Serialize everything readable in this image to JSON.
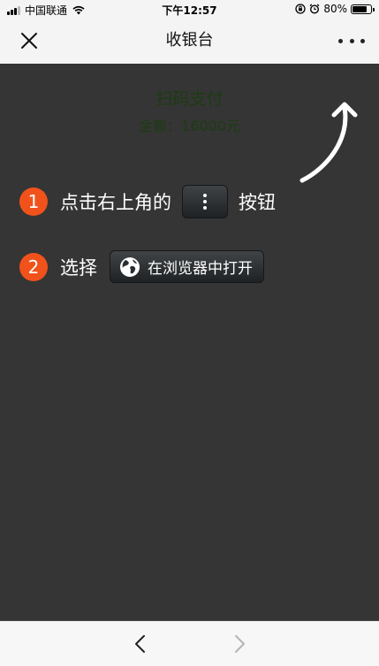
{
  "status_bar": {
    "carrier": "中国联通",
    "time": "下午12:57",
    "battery_text": "80%",
    "battery_level": 0.8,
    "signal_bars_active": 3,
    "signal_bars_total": 4,
    "icons": [
      "signal-icon",
      "wifi-icon",
      "lock-rotation-icon",
      "alarm-icon",
      "battery-icon"
    ]
  },
  "nav": {
    "title": "收银台",
    "close_icon": "close-icon",
    "more_icon": "more-dots-icon"
  },
  "page": {
    "pay_title": "扫码支付",
    "amount": "金额：16000元"
  },
  "overlay": {
    "step1": {
      "number": "1",
      "text_before": "点击右上角的",
      "text_after": "按钮"
    },
    "step2": {
      "number": "2",
      "text_before": "选择",
      "button_label": "在浏览器中打开"
    },
    "accent_color": "#f1521b",
    "overlay_color": "#353535"
  },
  "bottom_bar": {
    "back_icon": "chevron-left-icon",
    "forward_icon": "chevron-right-icon"
  }
}
